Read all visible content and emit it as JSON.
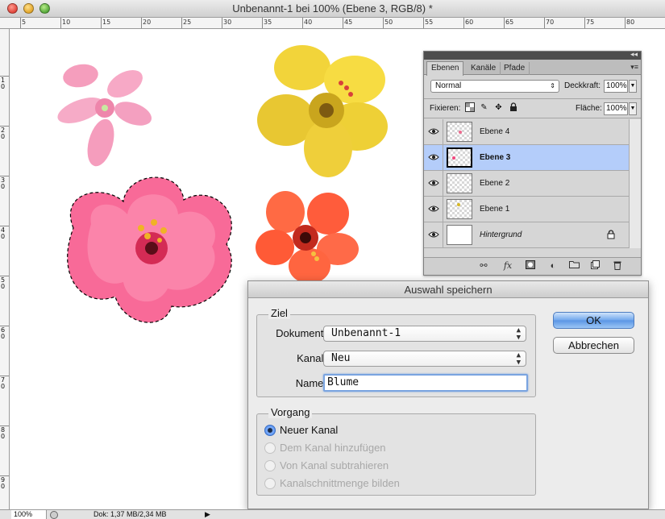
{
  "window": {
    "title": "Unbenannt-1 bei 100% (Ebene 3, RGB/8) *"
  },
  "ruler_top": [
    "5",
    "10",
    "15",
    "20",
    "25",
    "30",
    "35",
    "40",
    "45",
    "50",
    "55",
    "60",
    "65",
    "70",
    "75",
    "80"
  ],
  "ruler_left": [
    "1 0",
    "2 0",
    "3 0",
    "4 0",
    "5 0",
    "6 0",
    "7 0",
    "8 0",
    "9 0"
  ],
  "status": {
    "zoom": "100%",
    "doc": "Dok: 1,37 MB/2,34 MB"
  },
  "layers_panel": {
    "tabs": [
      "Ebenen",
      "Kanäle",
      "Pfade"
    ],
    "blend_mode": "Normal",
    "opacity_label": "Deckkraft:",
    "opacity_value": "100%",
    "lock_label": "Fixieren:",
    "fill_label": "Fläche:",
    "fill_value": "100%",
    "layers": [
      {
        "name": "Ebene 4",
        "selected": false
      },
      {
        "name": "Ebene 3",
        "selected": true
      },
      {
        "name": "Ebene 2",
        "selected": false
      },
      {
        "name": "Ebene 1",
        "selected": false
      },
      {
        "name": "Hintergrund",
        "selected": false
      }
    ],
    "footer_icons": [
      "link-icon",
      "fx-icon",
      "mask-icon",
      "adjustment-icon",
      "folder-icon",
      "new-layer-icon",
      "trash-icon"
    ],
    "footer_fx": "fx"
  },
  "dialog": {
    "title": "Auswahl speichern",
    "ziel_legend": "Ziel",
    "dokument_label": "Dokument:",
    "dokument_value": "Unbenannt-1",
    "kanal_label": "Kanal:",
    "kanal_value": "Neu",
    "name_label": "Name:",
    "name_value": "Blume",
    "vorgang_legend": "Vorgang",
    "options": [
      {
        "label": "Neuer Kanal",
        "checked": true,
        "enabled": true
      },
      {
        "label": "Dem Kanal hinzufügen",
        "checked": false,
        "enabled": false
      },
      {
        "label": "Von Kanal subtrahieren",
        "checked": false,
        "enabled": false
      },
      {
        "label": "Kanalschnittmenge bilden",
        "checked": false,
        "enabled": false
      }
    ],
    "ok_label": "OK",
    "cancel_label": "Abbrechen"
  },
  "colors": {
    "selection_blue": "#b4cdfa",
    "default_button": "#5a95e4",
    "flower_pink_light": "#f7a6c4",
    "flower_yellow": "#f0d43a",
    "flower_pink_hot": "#f7608e",
    "flower_orange_red": "#ff5d3c"
  }
}
